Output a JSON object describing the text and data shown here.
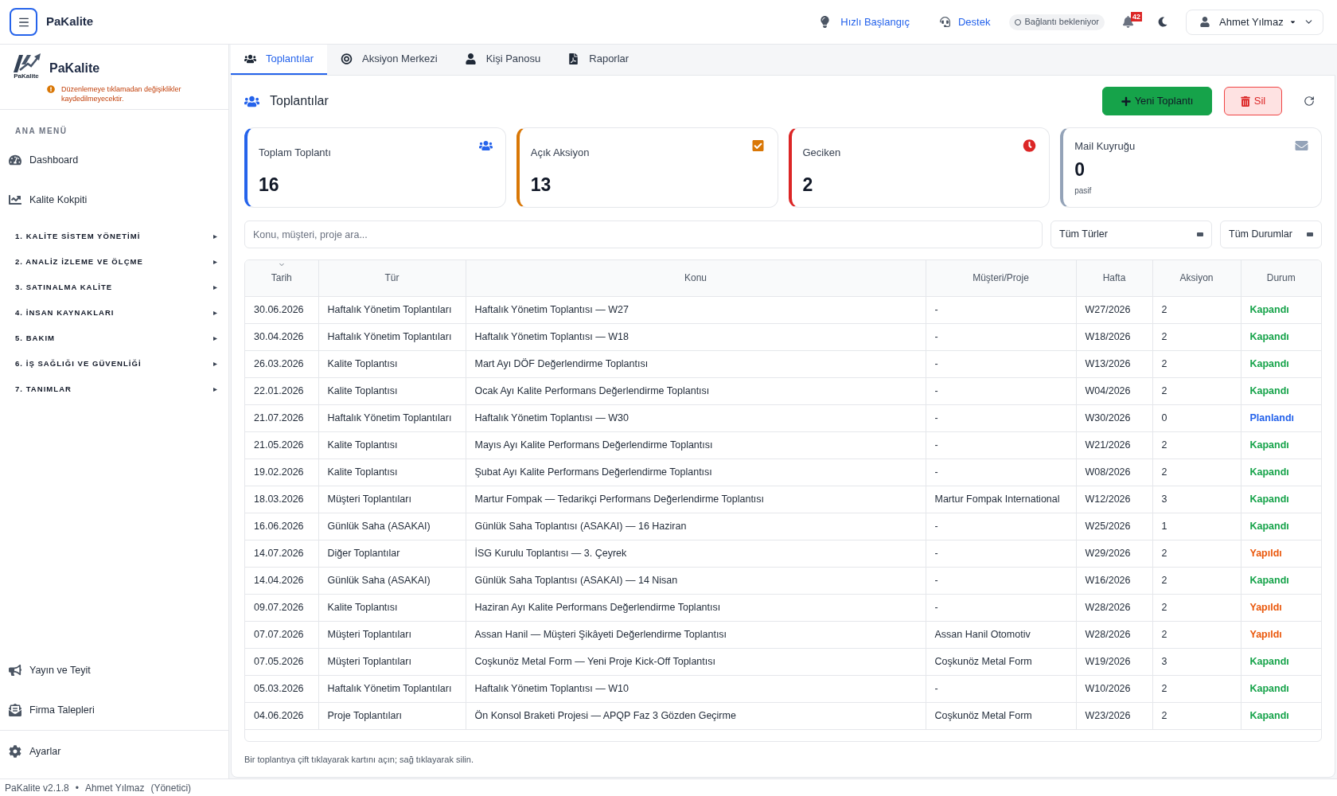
{
  "topbar": {
    "app_name": "PaKalite",
    "links": [
      {
        "label": "Hızlı Başlangıç",
        "kind": "quickstart"
      },
      {
        "label": "Destek",
        "kind": "support"
      }
    ],
    "connection_status": "Bağlantı bekleniyor",
    "notification_count": "42",
    "user_name": "Ahmet Yılmaz"
  },
  "sidebar": {
    "logo_caption": "PaKalite",
    "brand_name": "PaKalite",
    "warning": "Düzenlemeye tıklamadan değişiklikler kaydedilmeyecektir.",
    "section_title": "ANA MENÜ",
    "items": [
      {
        "label": "Dashboard",
        "kind": "dashboard"
      },
      {
        "label": "Kalite Kokpiti",
        "kind": "cockpit"
      }
    ],
    "groups": [
      {
        "label": "1. KALİTE SİSTEM YÖNETİMİ",
        "expanded": false
      },
      {
        "label": "2. ANALİZ İZLEME VE ÖLÇME",
        "expanded": false
      },
      {
        "label": "3. SATINALMA KALİTE",
        "expanded": false
      },
      {
        "label": "4. İNSAN KAYNAKLARI",
        "expanded": false
      },
      {
        "label": "5. BAKIM",
        "expanded": false
      },
      {
        "label": "6. İŞ SAĞLIĞI VE GÜVENLİĞİ",
        "expanded": false
      },
      {
        "label": "7. TANIMLAR",
        "expanded": false
      }
    ],
    "bottom_items": [
      {
        "label": "Yayın ve Teyit",
        "kind": "broadcast"
      },
      {
        "label": "Firma Talepleri",
        "kind": "requests"
      }
    ],
    "settings": {
      "label": "Ayarlar",
      "kind": "settings"
    }
  },
  "tabs": [
    {
      "label": "Toplantılar",
      "kind": "meetings",
      "selected": true
    },
    {
      "label": "Aksiyon Merkezi",
      "kind": "actions",
      "selected": false
    },
    {
      "label": "Kişi Panosu",
      "kind": "people",
      "selected": false
    },
    {
      "label": "Raporlar",
      "kind": "reports",
      "selected": false
    }
  ],
  "panel": {
    "title": "Toplantılar",
    "buttons": [
      {
        "label": "Yeni Toplantı",
        "kind": "create"
      },
      {
        "label": "Sil",
        "kind": "delete"
      }
    ],
    "stats": [
      {
        "label": "Toplam Toplantı",
        "value": "16",
        "kind": "meetings",
        "color": "#2563eb"
      },
      {
        "label": "Açık Aksiyon",
        "value": "13",
        "kind": "actions",
        "color": "#d97706"
      },
      {
        "label": "Geciken",
        "value": "2",
        "kind": "overdue",
        "color": "#dc2626"
      },
      {
        "label": "Mail Kuyruğu",
        "value": "0",
        "note": "pasif",
        "kind": "mail",
        "color": "#94a3b8"
      }
    ],
    "search": {
      "placeholder": "Konu, müşteri, proje ara..."
    },
    "filters": [
      {
        "value": "Tüm Türler"
      },
      {
        "value": "Tüm Durumlar"
      }
    ],
    "table": {
      "columns": [
        {
          "label": "Tarih",
          "sorted": true
        },
        {
          "label": "Tür",
          "sorted": false
        },
        {
          "label": "Konu",
          "sorted": false
        },
        {
          "label": "Müşteri/Proje",
          "sorted": false
        },
        {
          "label": "Hafta",
          "sorted": false
        },
        {
          "label": "Aksiyon",
          "sorted": false
        },
        {
          "label": "Durum",
          "sorted": false
        }
      ],
      "rows": [
        {
          "cells": [
            "30.06.2026",
            "Haftalık Yönetim Toplantıları",
            "Haftalık Yönetim Toplantısı — W27",
            "-",
            "W27/2026",
            "2"
          ],
          "status": {
            "label": "Kapandı",
            "color": "#16a34a"
          }
        },
        {
          "cells": [
            "30.04.2026",
            "Haftalık Yönetim Toplantıları",
            "Haftalık Yönetim Toplantısı — W18",
            "-",
            "W18/2026",
            "2"
          ],
          "status": {
            "label": "Kapandı",
            "color": "#16a34a"
          }
        },
        {
          "cells": [
            "26.03.2026",
            "Kalite Toplantısı",
            "Mart Ayı DÖF Değerlendirme Toplantısı",
            "-",
            "W13/2026",
            "2"
          ],
          "status": {
            "label": "Kapandı",
            "color": "#16a34a"
          }
        },
        {
          "cells": [
            "22.01.2026",
            "Kalite Toplantısı",
            "Ocak Ayı Kalite Performans Değerlendirme Toplantısı",
            "-",
            "W04/2026",
            "2"
          ],
          "status": {
            "label": "Kapandı",
            "color": "#16a34a"
          }
        },
        {
          "cells": [
            "21.07.2026",
            "Haftalık Yönetim Toplantıları",
            "Haftalık Yönetim Toplantısı — W30",
            "-",
            "W30/2026",
            "0"
          ],
          "status": {
            "label": "Planlandı",
            "color": "#2563eb"
          }
        },
        {
          "cells": [
            "21.05.2026",
            "Kalite Toplantısı",
            "Mayıs Ayı Kalite Performans Değerlendirme Toplantısı",
            "-",
            "W21/2026",
            "2"
          ],
          "status": {
            "label": "Kapandı",
            "color": "#16a34a"
          }
        },
        {
          "cells": [
            "19.02.2026",
            "Kalite Toplantısı",
            "Şubat Ayı Kalite Performans Değerlendirme Toplantısı",
            "-",
            "W08/2026",
            "2"
          ],
          "status": {
            "label": "Kapandı",
            "color": "#16a34a"
          }
        },
        {
          "cells": [
            "18.03.2026",
            "Müşteri Toplantıları",
            "Martur Fompak — Tedarikçi Performans Değerlendirme Toplantısı",
            "Martur Fompak International",
            "W12/2026",
            "3"
          ],
          "status": {
            "label": "Kapandı",
            "color": "#16a34a"
          }
        },
        {
          "cells": [
            "16.06.2026",
            "Günlük Saha (ASAKAI)",
            "Günlük Saha Toplantısı (ASAKAI) — 16 Haziran",
            "-",
            "W25/2026",
            "1"
          ],
          "status": {
            "label": "Kapandı",
            "color": "#16a34a"
          }
        },
        {
          "cells": [
            "14.07.2026",
            "Diğer Toplantılar",
            "İSG Kurulu Toplantısı — 3. Çeyrek",
            "-",
            "W29/2026",
            "2"
          ],
          "status": {
            "label": "Yapıldı",
            "color": "#ea580c"
          }
        },
        {
          "cells": [
            "14.04.2026",
            "Günlük Saha (ASAKAI)",
            "Günlük Saha Toplantısı (ASAKAI) — 14 Nisan",
            "-",
            "W16/2026",
            "2"
          ],
          "status": {
            "label": "Kapandı",
            "color": "#16a34a"
          }
        },
        {
          "cells": [
            "09.07.2026",
            "Kalite Toplantısı",
            "Haziran Ayı Kalite Performans Değerlendirme Toplantısı",
            "-",
            "W28/2026",
            "2"
          ],
          "status": {
            "label": "Yapıldı",
            "color": "#ea580c"
          }
        },
        {
          "cells": [
            "07.07.2026",
            "Müşteri Toplantıları",
            "Assan Hanil — Müşteri Şikâyeti Değerlendirme Toplantısı",
            "Assan Hanil Otomotiv",
            "W28/2026",
            "2"
          ],
          "status": {
            "label": "Yapıldı",
            "color": "#ea580c"
          }
        },
        {
          "cells": [
            "07.05.2026",
            "Müşteri Toplantıları",
            "Coşkunöz Metal Form — Yeni Proje Kick-Off Toplantısı",
            "Coşkunöz Metal Form",
            "W19/2026",
            "3"
          ],
          "status": {
            "label": "Kapandı",
            "color": "#16a34a"
          }
        },
        {
          "cells": [
            "05.03.2026",
            "Haftalık Yönetim Toplantıları",
            "Haftalık Yönetim Toplantısı — W10",
            "-",
            "W10/2026",
            "2"
          ],
          "status": {
            "label": "Kapandı",
            "color": "#16a34a"
          }
        },
        {
          "cells": [
            "04.06.2026",
            "Proje Toplantıları",
            "Ön Konsol Braketi Projesi — APQP Faz 3 Gözden Geçirme",
            "Coşkunöz Metal Form",
            "W23/2026",
            "2"
          ],
          "status": {
            "label": "Kapandı",
            "color": "#16a34a"
          }
        }
      ]
    },
    "hint": "Bir toplantıya çift tıklayarak kartını açın; sağ tıklayarak silin."
  },
  "footer": {
    "version": "PaKalite v2.1.8",
    "separator": "•",
    "user": "Ahmet Yılmaz",
    "role": "(Yönetici)"
  }
}
